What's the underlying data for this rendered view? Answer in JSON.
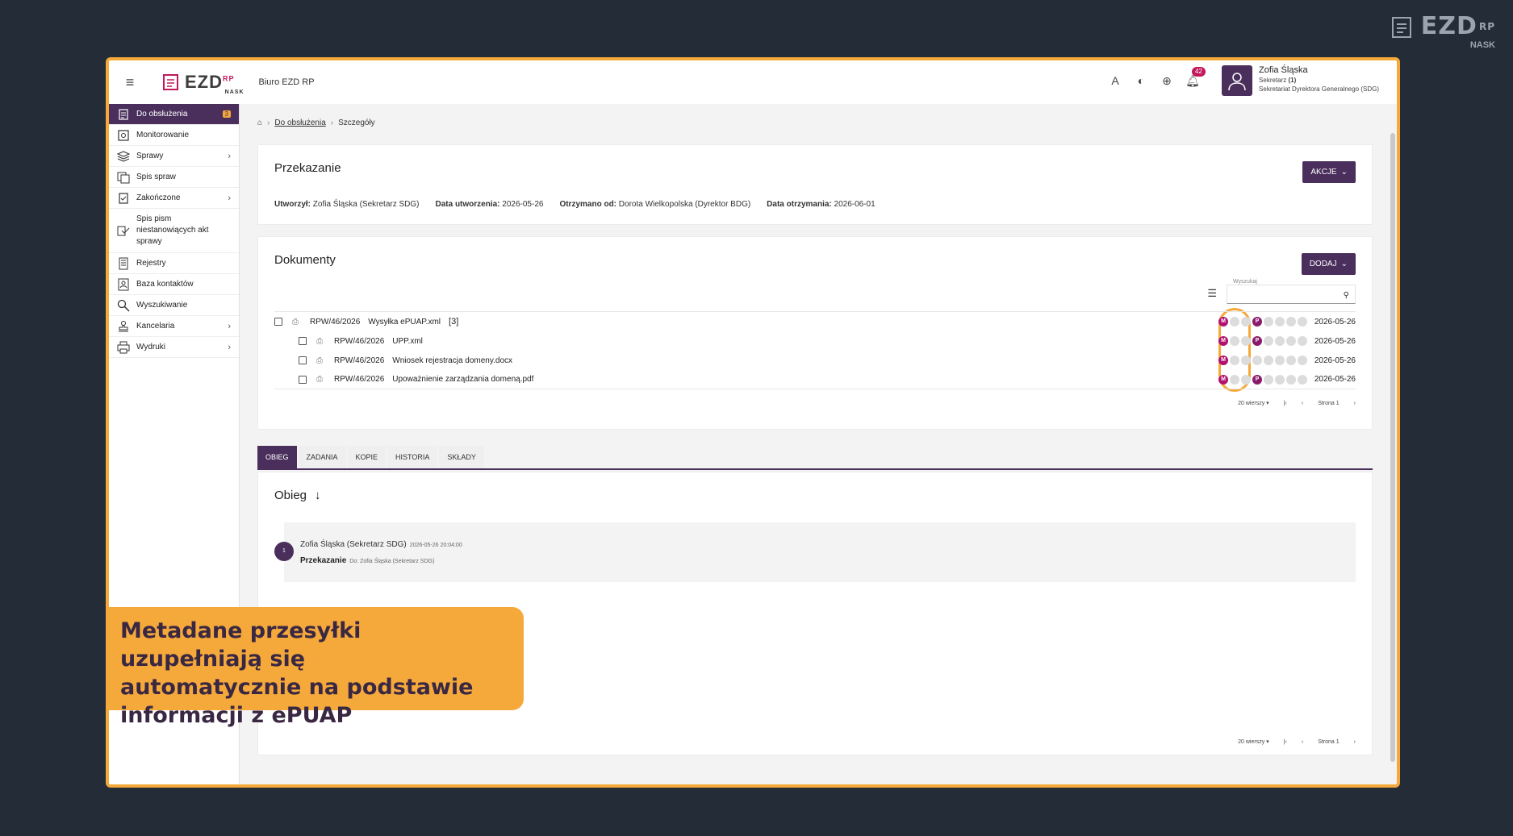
{
  "brand_corner": {
    "logo": "EZD",
    "rp": "RP",
    "nask": "NASK"
  },
  "app": {
    "logo": "EZD",
    "rp": "RP",
    "nask": "NASK",
    "name": "Biuro EZD RP",
    "notifications": "42"
  },
  "user": {
    "name": "Zofia Śląska",
    "role_prefix": "Sekretarz ",
    "role_count": "(1)",
    "unit": "Sekretariat Dyrektora Generalnego (SDG)"
  },
  "sidebar": {
    "items": [
      {
        "label": "Do obsłużenia",
        "badge": "3",
        "chevron": false,
        "icon": "clipboard-icon"
      },
      {
        "label": "Monitorowanie",
        "chevron": false,
        "icon": "eye-icon"
      },
      {
        "label": "Sprawy",
        "chevron": true,
        "icon": "layers-icon"
      },
      {
        "label": "Spis spraw",
        "chevron": false,
        "icon": "list-icon"
      },
      {
        "label": "Zakończone",
        "chevron": true,
        "icon": "check-clipboard-icon"
      },
      {
        "label": "Spis pism niestanowiących akt sprawy",
        "chevron": false,
        "icon": "documents-icon"
      },
      {
        "label": "Rejestry",
        "chevron": false,
        "icon": "register-icon"
      },
      {
        "label": "Baza kontaktów",
        "chevron": false,
        "icon": "contacts-icon"
      },
      {
        "label": "Wyszukiwanie",
        "chevron": false,
        "icon": "search-icon"
      },
      {
        "label": "Kancelaria",
        "chevron": true,
        "icon": "stamp-icon"
      },
      {
        "label": "Wydruki",
        "chevron": true,
        "icon": "printer-icon"
      }
    ]
  },
  "breadcrumb": {
    "link": "Do obsłużenia",
    "current": "Szczegóły"
  },
  "details": {
    "title": "Przekazanie",
    "actions_label": "AKCJE",
    "created_by_label": "Utworzył:",
    "created_by": "Zofia Śląska (Sekretarz SDG)",
    "created_date_label": "Data utworzenia:",
    "created_date": "2026-05-26",
    "received_from_label": "Otrzymano od:",
    "received_from": "Dorota Wielkopolska (Dyrektor BDG)",
    "received_date_label": "Data otrzymania:",
    "received_date": "2026-06-01"
  },
  "documents": {
    "title": "Dokumenty",
    "add_label": "DODAJ",
    "search_label": "Wyszukaj",
    "rows": [
      {
        "number": "RPW/46/2026",
        "name": "Wysyłka ePUAP.xml",
        "count": "[3]",
        "date": "2026-05-26"
      },
      {
        "number": "RPW/46/2026",
        "name": "UPP.xml",
        "date": "2026-05-26"
      },
      {
        "number": "RPW/46/2026",
        "name": "Wniosek rejestracja domeny.docx",
        "date": "2026-05-26"
      },
      {
        "number": "RPW/46/2026",
        "name": "Upoważnienie zarządzania domeną.pdf",
        "date": "2026-05-26"
      }
    ],
    "flags": [
      "M",
      "",
      "",
      "P",
      "",
      "",
      "",
      ""
    ],
    "flags_row3": [
      "M",
      "",
      "",
      "",
      "",
      "",
      "",
      ""
    ],
    "pager": {
      "rows": "20 wierszy",
      "page": "Strona 1"
    }
  },
  "tabs": [
    "OBIEG",
    "ZADANIA",
    "KOPIE",
    "HISTORIA",
    "SKŁADY"
  ],
  "obieg": {
    "title": "Obieg",
    "step": "1",
    "author": "Zofia Śląska (Sekretarz SDG)",
    "time": "2026-05-26 20:04:00",
    "action": "Przekazanie",
    "to": "Do: Zofia Śląska (Sekretarz SDG)",
    "pager": {
      "rows": "20 wierszy",
      "page": "Strona 1"
    }
  },
  "callout": {
    "line1": "Metadane przesyłki uzupełniają się",
    "line2": "automatycznie na podstawie",
    "line3": "informacji z ePUAP"
  },
  "colors": {
    "accent": "#4a2f5c",
    "highlight": "#f6a93b",
    "flag": "#b0126e",
    "background": "#242c38"
  }
}
